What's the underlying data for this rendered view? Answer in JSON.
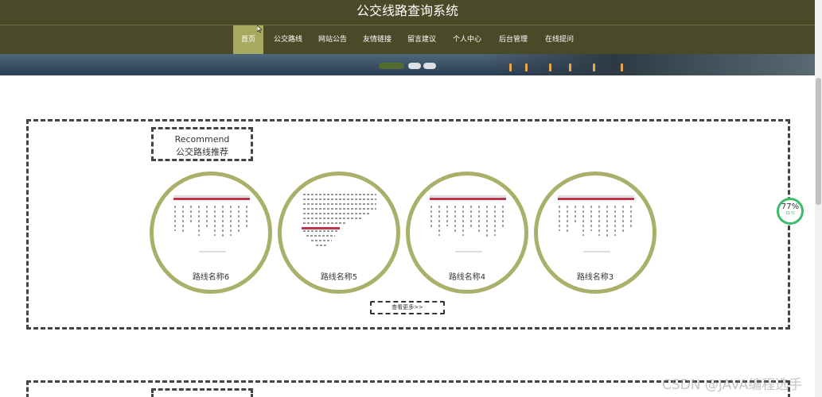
{
  "header": {
    "title": "公交线路查询系统"
  },
  "nav": {
    "items": [
      {
        "label": "首页",
        "active": true
      },
      {
        "label": "公交路线",
        "active": false
      },
      {
        "label": "网站公告",
        "active": false
      },
      {
        "label": "友情链接",
        "active": false
      },
      {
        "label": "留言建议",
        "active": false
      },
      {
        "label": "个人中心",
        "active": false
      },
      {
        "label": "后台管理",
        "active": false
      },
      {
        "label": "在线提问",
        "active": false
      }
    ]
  },
  "recommend": {
    "title_en": "Recommend",
    "title_cn": "公交路线推荐",
    "routes": [
      {
        "name": "路线名称6"
      },
      {
        "name": "路线名称5"
      },
      {
        "name": "路线名称4"
      },
      {
        "name": "路线名称3"
      }
    ],
    "more_label": "查看更多>>"
  },
  "widget": {
    "percent": "77%",
    "temp": "31°C"
  },
  "watermark": "CSDN @JAVA编程选手",
  "colors": {
    "header_bg": "#4b4a28",
    "accent": "#a7a95f",
    "circle_border": "#aab06a"
  }
}
